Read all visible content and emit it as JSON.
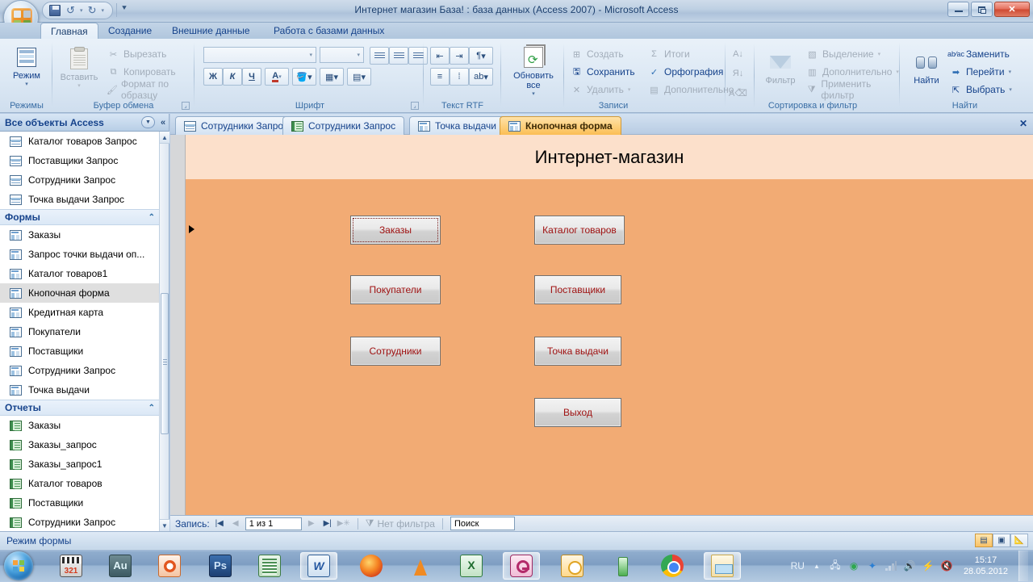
{
  "window": {
    "title": "Интернет магазин База! : база данных (Access 2007)  -  Microsoft Access",
    "minimize_label": "",
    "restore_label": "",
    "close_label": "✕"
  },
  "quick_access": {
    "office_button": "office-logo",
    "save": "save-icon",
    "undo": "↶",
    "redo": "↷",
    "customize": "⏷"
  },
  "ribbon": {
    "tabs": [
      {
        "label": "Главная",
        "active": true
      },
      {
        "label": "Создание",
        "active": false
      },
      {
        "label": "Внешние данные",
        "active": false
      },
      {
        "label": "Работа с базами данных",
        "active": false
      }
    ],
    "groups": [
      {
        "name": "Режимы",
        "items": [
          {
            "label": "Режим",
            "icon": "view-grid-icon",
            "dropdown": "▾"
          }
        ]
      },
      {
        "name": "Буфер обмена",
        "items": [
          {
            "label": "Вставить",
            "icon": "paste-icon",
            "dropdown": "▾",
            "disabled": true
          },
          {
            "label": "Вырезать",
            "icon": "scissors-icon",
            "disabled": true
          },
          {
            "label": "Копировать",
            "icon": "copy-icon",
            "disabled": true
          },
          {
            "label": "Формат по образцу",
            "icon": "format-painter-icon",
            "disabled": true
          }
        ]
      },
      {
        "name": "Шрифт",
        "font_name_value": "",
        "font_size_value": "",
        "items": [
          {
            "label": "Ж",
            "icon": "bold-icon"
          },
          {
            "label": "К",
            "icon": "italic-icon"
          },
          {
            "label": "Ч",
            "icon": "underline-icon"
          },
          {
            "label": "A",
            "icon": "font-color-icon"
          },
          {
            "label": "",
            "icon": "fill-color-icon"
          },
          {
            "label": "",
            "icon": "gridlines-icon"
          },
          {
            "label": "",
            "icon": "alternate-fill-icon"
          },
          {
            "label": "",
            "icon": "align-left-icon"
          },
          {
            "label": "",
            "icon": "align-center-icon"
          },
          {
            "label": "",
            "icon": "align-right-icon"
          }
        ]
      },
      {
        "name": "Текст RTF",
        "items": [
          {
            "label": "",
            "icon": "decrease-indent-icon"
          },
          {
            "label": "",
            "icon": "increase-indent-icon"
          },
          {
            "label": "",
            "icon": "text-direction-icon"
          },
          {
            "label": "",
            "icon": "numbered-list-icon"
          },
          {
            "label": "",
            "icon": "bulleted-list-icon"
          },
          {
            "label": "",
            "icon": "text-highlight-icon"
          }
        ]
      },
      {
        "name": "Записи",
        "items": [
          {
            "label": "Обновить все",
            "icon": "refresh-all-icon",
            "dropdown": "▾"
          },
          {
            "label": "Создать",
            "icon": "new-record-icon",
            "disabled": true
          },
          {
            "label": "Сохранить",
            "icon": "save-record-icon",
            "disabled": false
          },
          {
            "label": "Удалить",
            "icon": "delete-record-icon",
            "dropdown": "▾",
            "disabled": true
          },
          {
            "label": "Итоги",
            "icon": "sigma-icon",
            "disabled": true
          },
          {
            "label": "Орфография",
            "icon": "spelling-icon",
            "disabled": false
          },
          {
            "label": "Дополнительно",
            "icon": "more-records-icon",
            "dropdown": "▾",
            "disabled": true
          }
        ]
      },
      {
        "name": "Сортировка и фильтр",
        "items": [
          {
            "label": "",
            "icon": "sort-ascending-icon",
            "disabled": true
          },
          {
            "label": "",
            "icon": "sort-descending-icon",
            "disabled": true
          },
          {
            "label": "",
            "icon": "clear-sort-icon",
            "disabled": true
          },
          {
            "label": "Фильтр",
            "icon": "funnel-icon",
            "disabled": true
          },
          {
            "label": "Выделение",
            "icon": "selection-icon",
            "dropdown": "▾",
            "disabled": true
          },
          {
            "label": "Дополнительно",
            "icon": "advanced-filter-icon",
            "dropdown": "▾",
            "disabled": true
          },
          {
            "label": "Применить фильтр",
            "icon": "toggle-filter-icon",
            "disabled": true
          }
        ]
      },
      {
        "name": "Найти",
        "items": [
          {
            "label": "Найти",
            "icon": "binoculars-icon"
          },
          {
            "label": "Заменить",
            "icon": "replace-icon"
          },
          {
            "label": "Перейти",
            "icon": "goto-arrow-icon",
            "dropdown": "▾"
          },
          {
            "label": "Выбрать",
            "icon": "select-cursor-icon",
            "dropdown": "▾"
          }
        ]
      }
    ]
  },
  "nav_pane": {
    "header": "Все объекты Access",
    "dropdown_icon": "chevron-down-icon",
    "collapse_icon": "double-chevron-left-icon",
    "items": [
      {
        "label": "Каталог товаров Запрос",
        "type": "query",
        "selected": false
      },
      {
        "label": "Поставщики Запрос",
        "type": "query",
        "selected": false
      },
      {
        "label": "Сотрудники Запрос",
        "type": "query",
        "selected": false
      },
      {
        "label": "Точка выдачи Запрос",
        "type": "query",
        "selected": false
      }
    ],
    "group_forms": {
      "label": "Формы",
      "chevron": "⌃"
    },
    "forms": [
      {
        "label": "Заказы",
        "type": "form",
        "selected": false
      },
      {
        "label": "Запрос точки выдачи оп...",
        "type": "form",
        "selected": false
      },
      {
        "label": "Каталог товаров1",
        "type": "form",
        "selected": false
      },
      {
        "label": "Кнопочная форма",
        "type": "form",
        "selected": true
      },
      {
        "label": "Кредитная карта",
        "type": "form",
        "selected": false
      },
      {
        "label": "Покупатели",
        "type": "form",
        "selected": false
      },
      {
        "label": "Поставщики",
        "type": "form",
        "selected": false
      },
      {
        "label": "Сотрудники Запрос",
        "type": "form",
        "selected": false
      },
      {
        "label": "Точка выдачи",
        "type": "form",
        "selected": false
      }
    ],
    "group_reports": {
      "label": "Отчеты",
      "chevron": "⌃"
    },
    "reports": [
      {
        "label": "Заказы",
        "type": "report",
        "selected": false
      },
      {
        "label": "Заказы_запрос",
        "type": "report",
        "selected": false
      },
      {
        "label": "Заказы_запрос1",
        "type": "report",
        "selected": false
      },
      {
        "label": "Каталог товаров",
        "type": "report",
        "selected": false
      },
      {
        "label": "Поставщики",
        "type": "report",
        "selected": false
      },
      {
        "label": "Сотрудники Запрос",
        "type": "report",
        "selected": false
      }
    ],
    "scroll_up": "▲",
    "scroll_down": "▼"
  },
  "doc_tabs": {
    "tabs": [
      {
        "label": "Сотрудники Запрос",
        "icon": "query-icon",
        "active": false
      },
      {
        "label": "Сотрудники Запрос",
        "icon": "report-icon",
        "active": false
      },
      {
        "label": "Точка выдачи",
        "icon": "form-icon",
        "active": false
      },
      {
        "label": "Кнопочная форма",
        "icon": "form-icon",
        "active": true
      }
    ],
    "close_label": "✕"
  },
  "form": {
    "title": "Интернет-магазин",
    "header_color": "#fce0cb",
    "body_color": "#f2ab74",
    "button_text_color": "#a01313",
    "buttons": [
      {
        "label": "Заказы",
        "focused": true
      },
      {
        "label": "Каталог товаров",
        "focused": false
      },
      {
        "label": "Покупатели",
        "focused": false
      },
      {
        "label": "Поставщики",
        "focused": false
      },
      {
        "label": "Сотрудники",
        "focused": false
      },
      {
        "label": "Точка выдачи",
        "focused": false
      },
      {
        "label": "Выход",
        "focused": false
      }
    ]
  },
  "record_nav": {
    "label": "Запись:",
    "first": "|◀",
    "prev": "◀",
    "value": "1 из 1",
    "next": "▶",
    "last": "▶|",
    "new": "▶✳",
    "filter_status": "Нет фильтра",
    "filter_icon": "filter-off-icon",
    "search_placeholder": "Поиск",
    "search_value": "Поиск"
  },
  "status_bar": {
    "text": "Режим формы",
    "view_buttons": [
      {
        "icon": "form-view-icon",
        "active": true
      },
      {
        "icon": "layout-view-icon",
        "active": false
      },
      {
        "icon": "design-view-icon",
        "active": false
      }
    ]
  },
  "taskbar": {
    "start": "start-orb-icon",
    "items": [
      {
        "name": "media-player-classic-icon",
        "cls": "ai-mpc",
        "open": false
      },
      {
        "name": "adobe-audition-icon",
        "cls": "ai-au",
        "open": false
      },
      {
        "name": "powerpoint-icon",
        "cls": "ai-ppt",
        "open": false
      },
      {
        "name": "photoshop-icon",
        "cls": "ai-ps",
        "open": false
      },
      {
        "name": "publisher-icon",
        "cls": "ai-pub",
        "open": false
      },
      {
        "name": "word-icon",
        "cls": "ai-word",
        "open": true
      },
      {
        "name": "firefox-icon",
        "cls": "ai-ff",
        "open": false
      },
      {
        "name": "vlc-icon",
        "cls": "ai-vlc",
        "open": false
      },
      {
        "name": "excel-icon",
        "cls": "ai-xl",
        "open": false
      },
      {
        "name": "access-icon",
        "cls": "ai-acc",
        "open": true
      },
      {
        "name": "outlook-icon",
        "cls": "ai-out",
        "open": false
      },
      {
        "name": "qip-icon",
        "cls": "ai-qip",
        "open": false
      },
      {
        "name": "chrome-icon",
        "cls": "ai-chrome",
        "open": false
      },
      {
        "name": "explorer-icon",
        "cls": "ai-expl",
        "open": true
      }
    ],
    "tray": {
      "language": "RU",
      "expand": "▲",
      "icons": [
        "safely-remove-icon",
        "utorrent-icon",
        "bluetooth-icon",
        "network-signal-icon",
        "volume-icon",
        "flash-icon",
        "mute-icon"
      ],
      "time": "15:17",
      "date": "28.05.2012"
    }
  }
}
